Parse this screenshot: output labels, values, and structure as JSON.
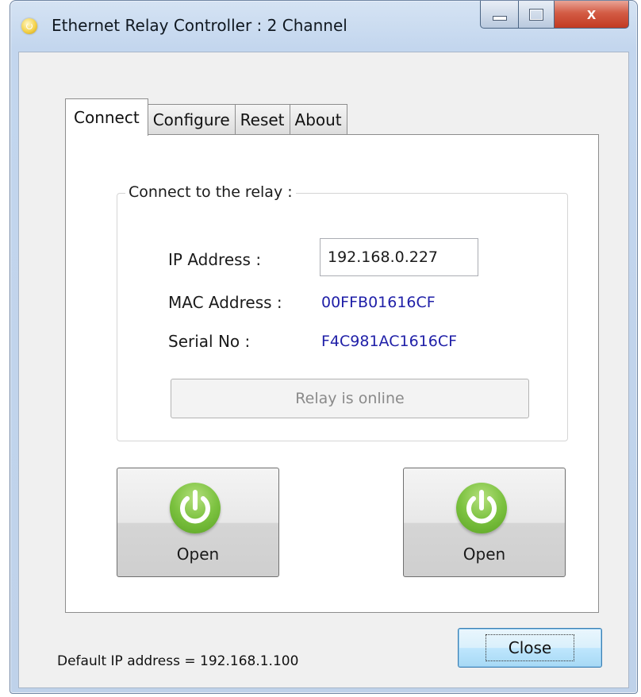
{
  "window": {
    "title": "Ethernet Relay Controller : 2 Channel",
    "icon": "power-app-icon",
    "caption": {
      "minimize": "",
      "maximize": "",
      "close": "x"
    }
  },
  "tabs": [
    {
      "label": "Connect",
      "active": true
    },
    {
      "label": "Configure",
      "active": false
    },
    {
      "label": "Reset",
      "active": false
    },
    {
      "label": "About",
      "active": false
    }
  ],
  "connect": {
    "group_title": "Connect to the relay :",
    "ip_label": "IP Address :",
    "ip_value": "192.168.0.227",
    "mac_label": "MAC Address :",
    "mac_value": "00FFB01616CF",
    "serial_label": "Serial No :",
    "serial_value": "F4C981AC1616CF",
    "status": "Relay is online"
  },
  "relays": [
    {
      "label": "Open",
      "icon": "power-icon"
    },
    {
      "label": "Open",
      "icon": "power-icon"
    }
  ],
  "footer": {
    "default_ip": "Default IP address = 192.168.1.100",
    "close_label": "Close"
  },
  "colors": {
    "value_text": "#2020a8",
    "power_green": "#7cc240",
    "close_button_red": "#c23a22"
  }
}
